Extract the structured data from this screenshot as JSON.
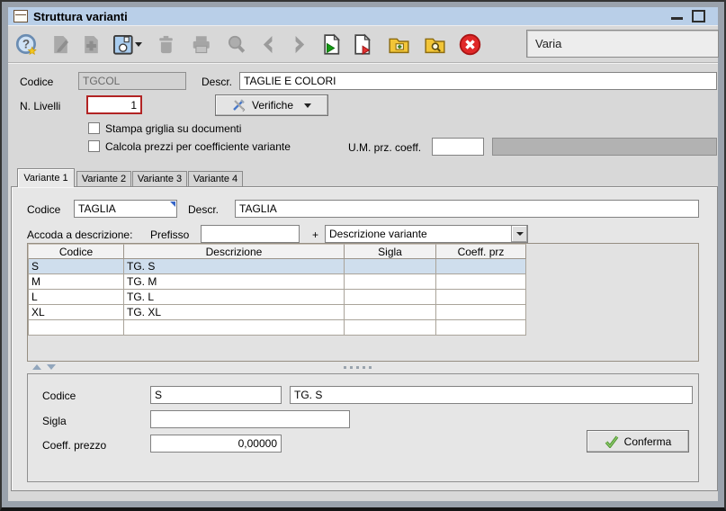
{
  "window": {
    "title": "Struttura varianti",
    "mode_value": "Varia",
    "controls": [
      "minimize",
      "maximize"
    ]
  },
  "colors": {
    "titlebar": "#b9cfe8",
    "selection_row": "#cfdeed",
    "focus_field_border": "#b22424",
    "folder_icon": "#f2c537",
    "cancel_icon": "#e02828",
    "save_icon": "#a9cdf0"
  },
  "toolbar": {
    "buttons": [
      {
        "name": "help-icon",
        "enabled": true
      },
      {
        "name": "edit-icon",
        "enabled": false
      },
      {
        "name": "copy-doc-icon",
        "enabled": false
      },
      {
        "name": "save-icon",
        "enabled": true,
        "has_dropdown": true
      },
      {
        "name": "delete-icon",
        "enabled": false
      },
      {
        "name": "print-icon",
        "enabled": false
      },
      {
        "name": "search-icon",
        "enabled": false
      },
      {
        "name": "prev-icon",
        "enabled": false
      },
      {
        "name": "next-icon",
        "enabled": false
      },
      {
        "name": "doc-export-green-icon",
        "enabled": true
      },
      {
        "name": "doc-export-red-icon",
        "enabled": true
      },
      {
        "name": "folder-add-icon",
        "enabled": true
      },
      {
        "name": "folder-search-icon",
        "enabled": true
      },
      {
        "name": "cancel-icon",
        "enabled": true
      }
    ]
  },
  "header_form": {
    "codice_label": "Codice",
    "codice_value": "TGCOL",
    "descr_label": "Descr.",
    "descr_value": "TAGLIE E COLORI",
    "livelli_label": "N. Livelli",
    "livelli_value": "1",
    "verifiche_label": "Verifiche",
    "checkbox_stampa_label": "Stampa griglia su documenti",
    "checkbox_stampa_checked": false,
    "checkbox_calcola_label": "Calcola prezzi per coefficiente variante",
    "checkbox_calcola_checked": false,
    "um_label": "U.M. prz. coeff.",
    "um_value": "",
    "um_desc_value": ""
  },
  "tabs": [
    {
      "label": "Variante 1",
      "active": true
    },
    {
      "label": "Variante 2",
      "active": false
    },
    {
      "label": "Variante 3",
      "active": false
    },
    {
      "label": "Variante 4",
      "active": false
    }
  ],
  "variant_form": {
    "codice_label": "Codice",
    "codice_value": "TAGLIA",
    "descr_label": "Descr.",
    "descr_value": "TAGLIA",
    "accoda_label": "Accoda a descrizione:",
    "prefisso_label": "Prefisso",
    "prefisso_value": "",
    "plus_label": "+",
    "combo_value": "Descrizione variante"
  },
  "table": {
    "columns": [
      "Codice",
      "Descrizione",
      "Sigla",
      "Coeff. prz"
    ],
    "rows": [
      [
        "S",
        "TG. S",
        "",
        ""
      ],
      [
        "M",
        "TG. M",
        "",
        ""
      ],
      [
        "L",
        "TG. L",
        "",
        ""
      ],
      [
        "XL",
        "TG. XL",
        "",
        ""
      ],
      [
        "",
        "",
        "",
        ""
      ]
    ],
    "selected_row": 0
  },
  "detail_form": {
    "codice_label": "Codice",
    "codice_value": "S",
    "descrizione_value": "TG. S",
    "sigla_label": "Sigla",
    "sigla_value": "",
    "coeff_label": "Coeff. prezzo",
    "coeff_value": "0,00000",
    "conferma_label": "Conferma"
  }
}
